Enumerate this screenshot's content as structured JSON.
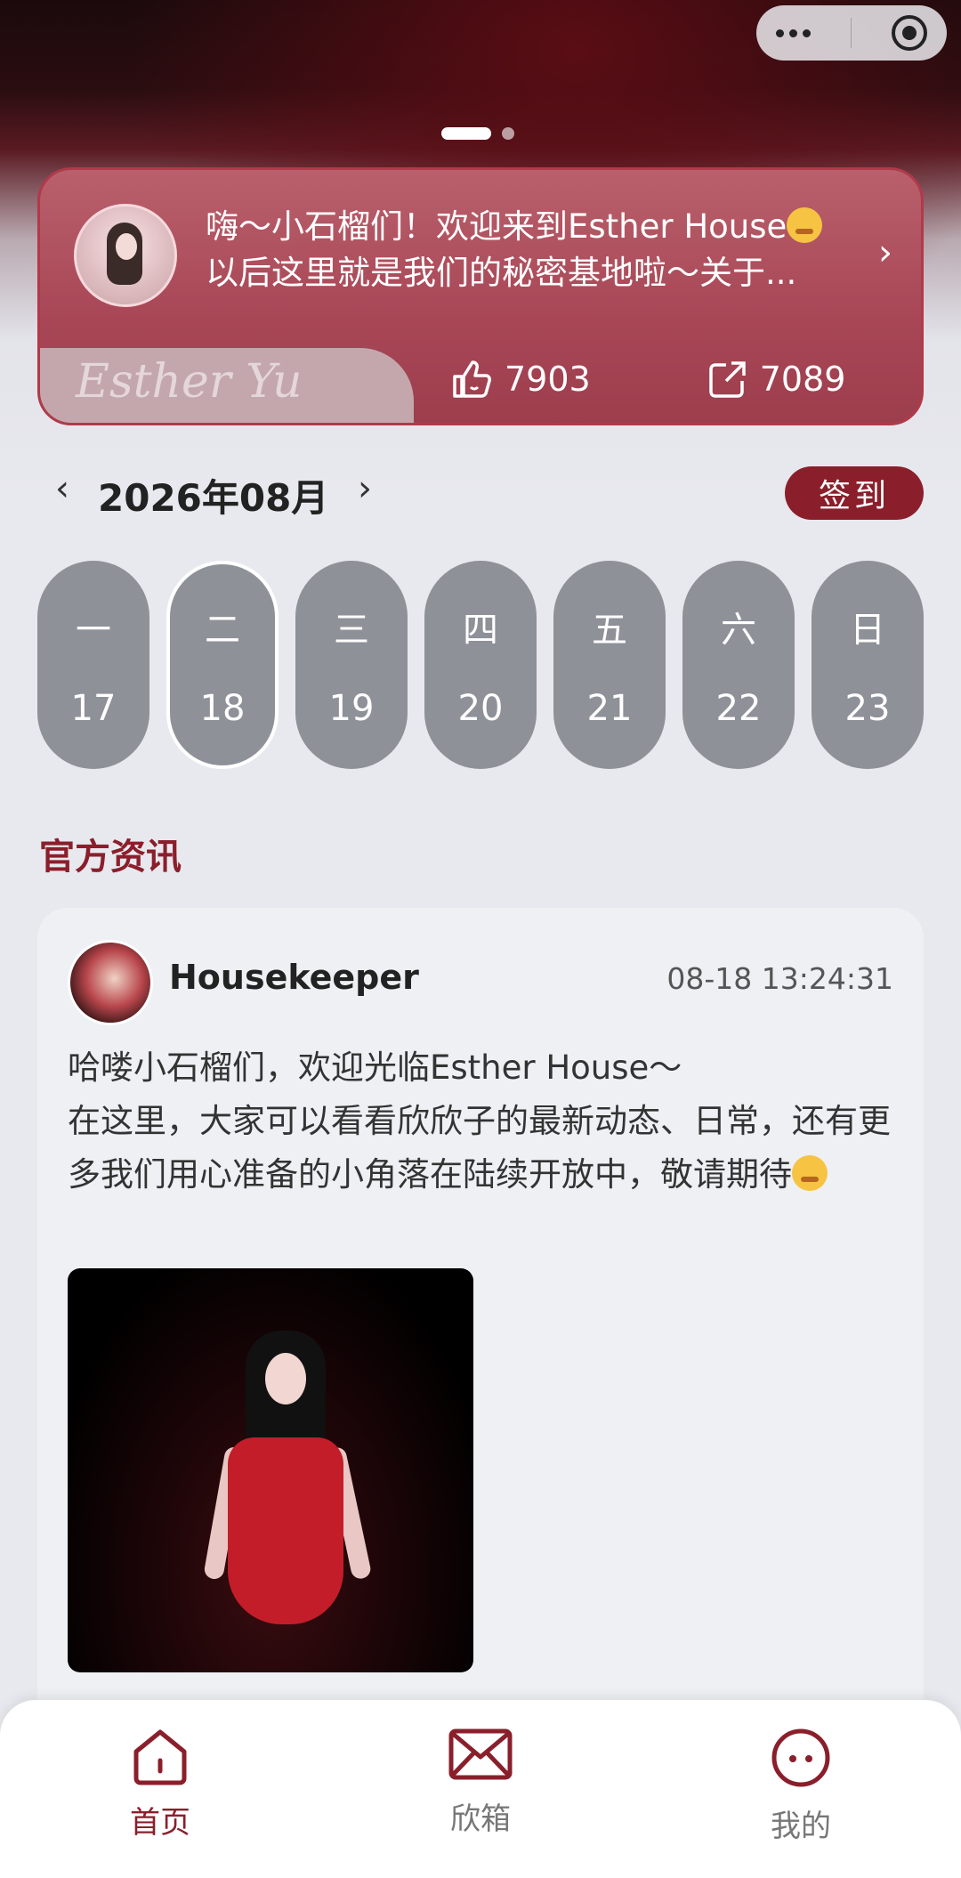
{
  "capsule": {
    "more_icon": "more-dots-icon",
    "close_icon": "target-close-icon"
  },
  "carousel": {
    "active_index": 0,
    "count": 2
  },
  "announcement": {
    "line1": "嗨～小石榴们！欢迎来到Esther House",
    "line2": "以后这里就是我们的秘密基地啦～关于...",
    "signature": "Esther Yu",
    "likes": "7903",
    "shares": "7089"
  },
  "calendar": {
    "month_label": "2026年08月",
    "checkin_label": "签到",
    "days": [
      {
        "weekday": "一",
        "date": "17"
      },
      {
        "weekday": "二",
        "date": "18"
      },
      {
        "weekday": "三",
        "date": "19"
      },
      {
        "weekday": "四",
        "date": "20"
      },
      {
        "weekday": "五",
        "date": "21"
      },
      {
        "weekday": "六",
        "date": "22"
      },
      {
        "weekday": "日",
        "date": "23"
      }
    ],
    "selected_index": 1
  },
  "section": {
    "title": "官方资讯"
  },
  "news": {
    "author": "Housekeeper",
    "time": "08-18 13:24:31",
    "line1": "哈喽小石榴们，欢迎光临Esther House～",
    "line2": "在这里，大家可以看看欣欣子的最新动态、日常，还有更多我们用心准备的小角落在陆续开放中，敬请期待"
  },
  "tabbar": {
    "home": "首页",
    "mail": "欣箱",
    "me": "我的"
  },
  "colors": {
    "accent": "#8a1f2b",
    "day_bg": "#8e9198",
    "card_bg": "#eef0f3"
  }
}
